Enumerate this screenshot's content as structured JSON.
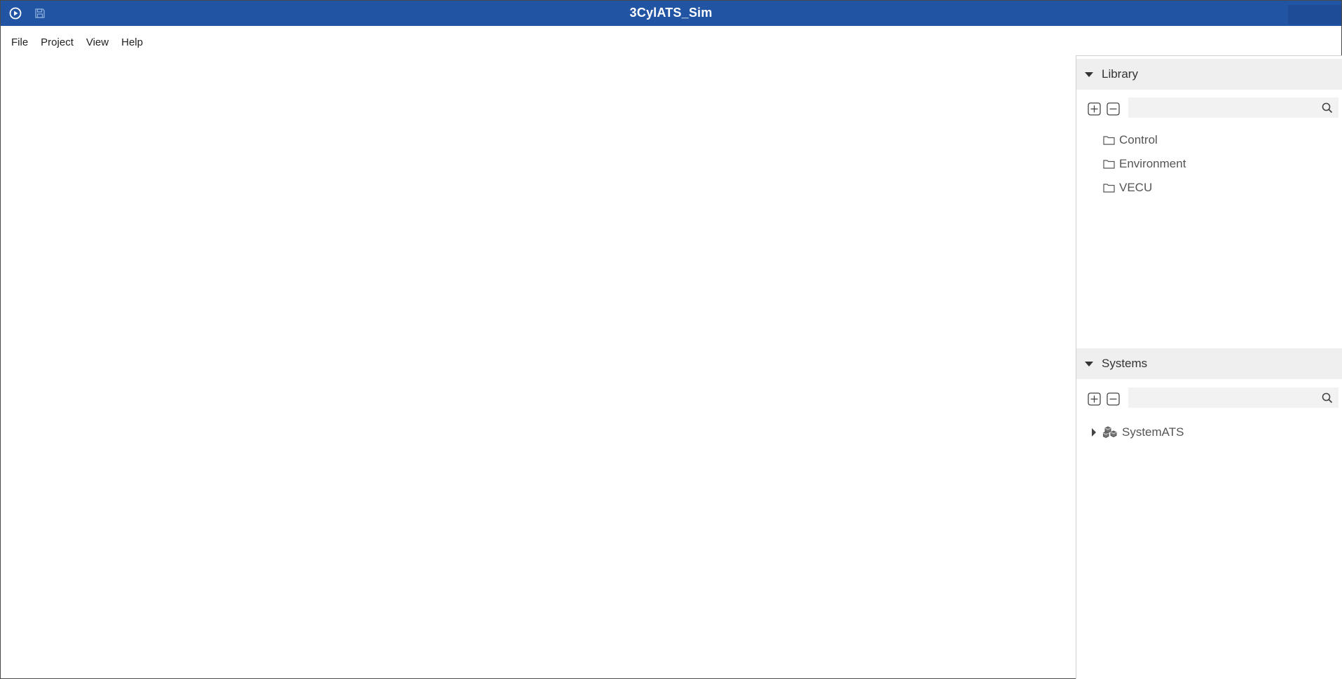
{
  "window": {
    "title": "3CylATS_Sim"
  },
  "titlebar": {
    "run_icon": "run-icon",
    "save_icon": "save-icon"
  },
  "menu": {
    "items": [
      "File",
      "Project",
      "View",
      "Help"
    ]
  },
  "library": {
    "header": "Library",
    "search_value": "",
    "items": [
      {
        "label": "Control",
        "icon": "folder-icon"
      },
      {
        "label": "Environment",
        "icon": "folder-icon"
      },
      {
        "label": "VECU",
        "icon": "folder-icon"
      }
    ]
  },
  "systems": {
    "header": "Systems",
    "search_value": "",
    "items": [
      {
        "label": "SystemATS",
        "icon": "system-cubes-icon",
        "expandable": true
      }
    ]
  },
  "colors": {
    "titlebar": "#2154a3",
    "section_header_bg": "#efefef",
    "search_bg": "#f2f2f2"
  }
}
